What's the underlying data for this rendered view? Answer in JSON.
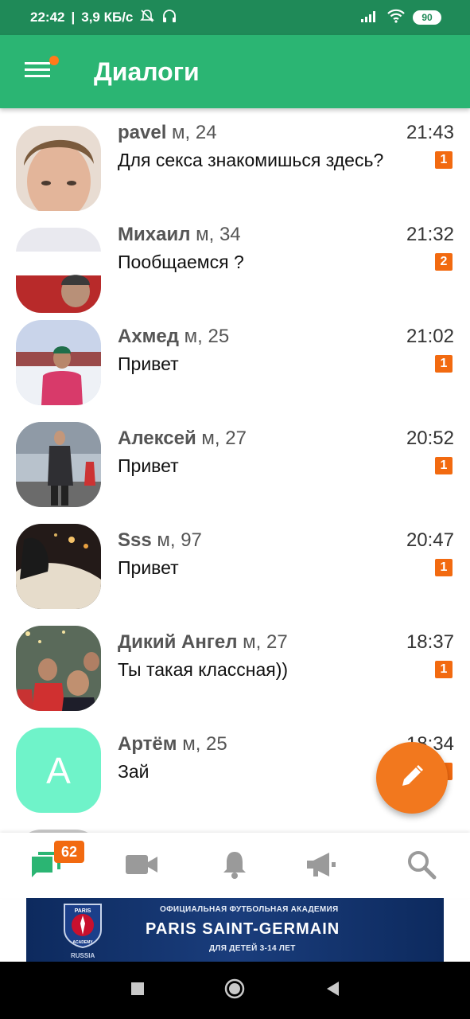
{
  "status_bar": {
    "time": "22:42",
    "network_speed": "3,9 КБ/с",
    "battery": "90"
  },
  "app_bar": {
    "title": "Диалоги"
  },
  "dialogs": [
    {
      "name": "pavel",
      "info": " м, 24",
      "time": "21:43",
      "message": "Для секса знакомишься здесь?",
      "unread": "1"
    },
    {
      "name": "Михаил",
      "info": " м, 34",
      "time": "21:32",
      "message": "Пообщаемся ?",
      "unread": "2"
    },
    {
      "name": "Ахмед",
      "info": " м, 25",
      "time": "21:02",
      "message": "Привет",
      "unread": "1"
    },
    {
      "name": "Алексей",
      "info": " м, 27",
      "time": "20:52",
      "message": "Привет",
      "unread": "1"
    },
    {
      "name": "Sss",
      "info": " м, 97",
      "time": "20:47",
      "message": "Привет",
      "unread": "1"
    },
    {
      "name": "Дикий Ангел",
      "info": " м, 27",
      "time": "18:37",
      "message": "Ты такая классная))",
      "unread": "1"
    },
    {
      "name": "Артём",
      "info": " м, 25",
      "time": "18:34",
      "message": "Зай",
      "unread": "1",
      "avatar_letter": "A"
    }
  ],
  "bottom_nav": {
    "messages_badge": "62",
    "icons": [
      "chat-icon",
      "video-icon",
      "bell-icon",
      "megaphone-icon",
      "search-icon"
    ]
  },
  "banner": {
    "line1": "ОФИЦИАЛЬНАЯ ФУТБОЛЬНАЯ АКАДЕМИЯ",
    "line2": "PARIS SAINT-GERMAIN",
    "line3": "ДЛЯ ДЕТЕЙ 3-14 ЛЕТ",
    "logo_top": "PARIS",
    "logo_bottom": "ACADEMY",
    "country": "RUSSIA"
  },
  "colors": {
    "status_bar": "#1f8a58",
    "app_bar": "#2bb573",
    "badge": "#f26a10",
    "fab": "#f2781e",
    "nav_active": "#2bb573",
    "nav_inactive": "#9a9a9a"
  }
}
